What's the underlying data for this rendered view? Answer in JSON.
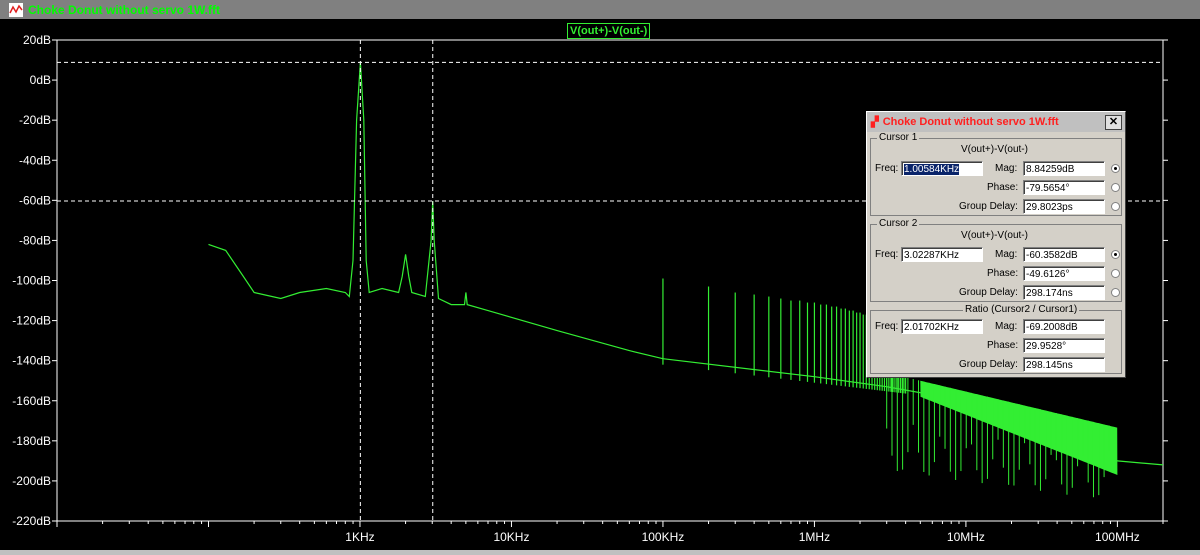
{
  "window": {
    "title": "Choke Donut without servo 1W.fft"
  },
  "trace_label": "V(out+)-V(out-)",
  "colors": {
    "trace": "#33ee33",
    "axis": "#ffffff",
    "cursor": "#ffffff"
  },
  "chart_data": {
    "type": "line",
    "title": "V(out+)-V(out-)",
    "x_scale": "log",
    "xlim_hz": [
      10,
      100000000
    ],
    "ylim_db": [
      -220,
      20
    ],
    "y_ticks": [
      "20dB",
      "0dB",
      "-20dB",
      "-40dB",
      "-60dB",
      "-80dB",
      "-100dB",
      "-120dB",
      "-140dB",
      "-160dB",
      "-180dB",
      "-200dB",
      "-220dB"
    ],
    "y_tick_values": [
      20,
      0,
      -20,
      -40,
      -60,
      -80,
      -100,
      -120,
      -140,
      -160,
      -180,
      -200,
      -220
    ],
    "x_ticks": [
      "1KHz",
      "10KHz",
      "100KHz",
      "1MHz",
      "10MHz",
      "100MHz"
    ],
    "x_tick_values": [
      1000,
      10000,
      100000,
      1000000,
      10000000,
      100000000
    ],
    "series": [
      {
        "name": "V(out+)-V(out-)",
        "points": [
          [
            100,
            -82
          ],
          [
            130,
            -85
          ],
          [
            170,
            -98
          ],
          [
            200,
            -106
          ],
          [
            300,
            -109
          ],
          [
            400,
            -106
          ],
          [
            600,
            -104
          ],
          [
            800,
            -106
          ],
          [
            850,
            -108
          ],
          [
            900,
            -90
          ],
          [
            950,
            -20
          ],
          [
            1006,
            8.8
          ],
          [
            1060,
            -20
          ],
          [
            1100,
            -90
          ],
          [
            1150,
            -106
          ],
          [
            1400,
            -104
          ],
          [
            1800,
            -106
          ],
          [
            1900,
            -98
          ],
          [
            2000,
            -87
          ],
          [
            2100,
            -98
          ],
          [
            2200,
            -106
          ],
          [
            2700,
            -108
          ],
          [
            2950,
            -80
          ],
          [
            3020,
            -60.4
          ],
          [
            3090,
            -80
          ],
          [
            3300,
            -109
          ],
          [
            4000,
            -112
          ],
          [
            4900,
            -112
          ],
          [
            5000,
            -106
          ],
          [
            5100,
            -112
          ],
          [
            7000,
            -115
          ],
          [
            20000,
            -125
          ],
          [
            60000,
            -135
          ],
          [
            100000,
            -139
          ],
          [
            1000000,
            -148
          ],
          [
            3000000,
            -153
          ],
          [
            10000000,
            -160
          ],
          [
            30000000,
            -170
          ],
          [
            60000000,
            -183
          ],
          [
            100000000,
            -190
          ],
          [
            200000000,
            -192
          ]
        ],
        "spikes_hz": [
          100000,
          200000,
          300000,
          400000,
          500000,
          600000,
          700000,
          800000,
          900000,
          1000000,
          1100000,
          1200000,
          1300000,
          1400000,
          1500000,
          1600000,
          1700000,
          1800000,
          1900000,
          2000000,
          2100000,
          2200000,
          2300000,
          2400000,
          2500000,
          2600000,
          2700000,
          2800000,
          2900000,
          3000000,
          3100000,
          3200000,
          3300000,
          3400000,
          3500000,
          3600000,
          3700000,
          3800000,
          3900000,
          4000000
        ],
        "spike_top_db": [
          -99,
          -103,
          -106,
          -107,
          -108,
          -109,
          -110,
          -110,
          -111,
          -111,
          -112,
          -112,
          -113,
          -113,
          -114,
          -114,
          -115,
          -115,
          -116,
          -116,
          -117,
          -117,
          -118,
          -118,
          -119,
          -119,
          -120,
          -120,
          -121,
          -121,
          -122,
          -122,
          -123,
          -123,
          -124,
          -124,
          -125,
          -125,
          -126,
          -126
        ]
      }
    ],
    "cursors": [
      {
        "freq_hz": 1005.84,
        "mag_db": 8.84259
      },
      {
        "freq_hz": 3022.87,
        "mag_db": -60.3582
      }
    ]
  },
  "dialog": {
    "title": "Choke Donut without servo 1W.fft",
    "close": "✕",
    "cursor1": {
      "group": "Cursor 1",
      "trace": "V(out+)-V(out-)",
      "freq_label": "Freq:",
      "freq": "1.00584KHz",
      "mag_label": "Mag:",
      "mag": "8.84259dB",
      "phase_label": "Phase:",
      "phase": "-79.5654°",
      "gd_label": "Group Delay:",
      "gd": "29.8023ps"
    },
    "cursor2": {
      "group": "Cursor 2",
      "trace": "V(out+)-V(out-)",
      "freq_label": "Freq:",
      "freq": "3.02287KHz",
      "mag_label": "Mag:",
      "mag": "-60.3582dB",
      "phase_label": "Phase:",
      "phase": "-49.6126°",
      "gd_label": "Group Delay:",
      "gd": "298.174ns"
    },
    "ratio": {
      "group": "Ratio (Cursor2 / Cursor1)",
      "freq_label": "Freq:",
      "freq": "2.01702KHz",
      "mag_label": "Mag:",
      "mag": "-69.2008dB",
      "phase_label": "Phase:",
      "phase": "29.9528°",
      "gd_label": "Group Delay:",
      "gd": "298.145ns"
    }
  }
}
